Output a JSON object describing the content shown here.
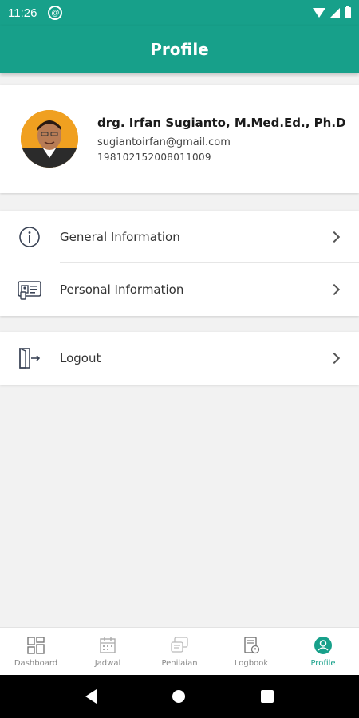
{
  "status_bar": {
    "time": "11:26",
    "at_symbol": "@"
  },
  "app_bar": {
    "title": "Profile"
  },
  "profile": {
    "name": "drg. Irfan Sugianto, M.Med.Ed., Ph.D",
    "email": "sugiantoirfan@gmail.com",
    "id_number": "198102152008011009"
  },
  "menu": {
    "general_info": "General Information",
    "personal_info": "Personal Information",
    "logout": "Logout"
  },
  "bottom_nav": {
    "items": [
      {
        "label": "Dashboard",
        "icon": "dashboard-icon"
      },
      {
        "label": "Jadwal",
        "icon": "calendar-icon"
      },
      {
        "label": "Penilaian",
        "icon": "assessment-icon"
      },
      {
        "label": "Logbook",
        "icon": "logbook-icon"
      },
      {
        "label": "Profile",
        "icon": "profile-icon"
      }
    ],
    "active_index": 4
  },
  "colors": {
    "primary": "#17a08a",
    "inactive": "#888888"
  }
}
